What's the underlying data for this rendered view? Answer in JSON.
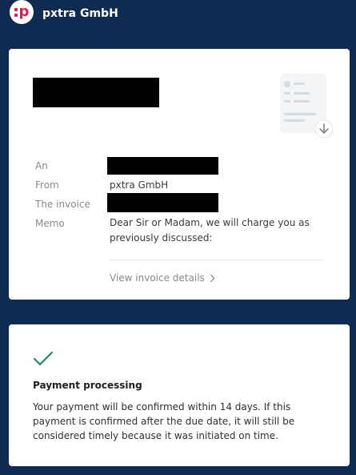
{
  "header": {
    "company": "pxtra GmbH",
    "logo_icon": "pxtra-logo"
  },
  "invoice_card": {
    "labels": {
      "to": "An",
      "from": "From",
      "invoice": "The invoice",
      "memo": "Memo"
    },
    "values": {
      "from": "pxtra GmbH",
      "memo": "Dear Sir or Madam, we will charge you as previously discussed:"
    },
    "link_label": "View invoice details",
    "illustration_icon": "document-download-icon"
  },
  "status_card": {
    "icon": "check-icon",
    "title": "Payment processing",
    "description": "Your payment will be confirmed within 14 days. If this payment is confirmed after the due date, it will still be considered timely because it was initiated on time."
  },
  "colors": {
    "background": "#0f2b52",
    "card": "#ffffff",
    "brand": "#e51a4c",
    "check": "#1f8a62"
  }
}
